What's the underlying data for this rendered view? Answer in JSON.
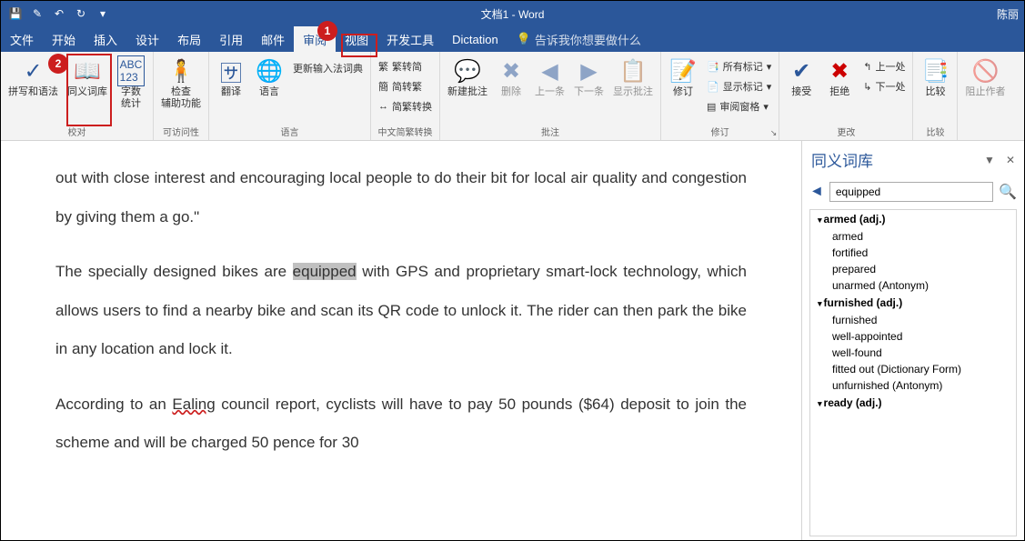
{
  "titlebar": {
    "doc_title": "文档1 - Word",
    "user": "陈丽"
  },
  "tabs": {
    "items": [
      "文件",
      "开始",
      "插入",
      "设计",
      "布局",
      "引用",
      "邮件",
      "审阅",
      "视图",
      "开发工具",
      "Dictation"
    ],
    "active_index": 7,
    "tell_me": "告诉我你想要做什么"
  },
  "badge1": "1",
  "badge2": "2",
  "ribbon": {
    "proofing": {
      "spelling": "拼写和语法",
      "thesaurus": "同义词库",
      "wordcount": "字数\n统计",
      "label": "校对"
    },
    "accessibility": {
      "check": "检查\n辅助功能",
      "label": "可访问性"
    },
    "language": {
      "translate": "翻译",
      "lang": "语言",
      "update_ime": "更新输入法词典",
      "label": "语言"
    },
    "chinese": {
      "sc": "繁转简",
      "tc": "简转繁",
      "convert": "简繁转换",
      "label": "中文简繁转换"
    },
    "comments": {
      "new": "新建批注",
      "delete": "删除",
      "prev": "上一条",
      "next": "下一条",
      "show": "显示批注",
      "label": "批注"
    },
    "tracking": {
      "track": "修订",
      "all_markup": "所有标记",
      "show_markup": "显示标记",
      "review_pane": "审阅窗格",
      "label": "修订"
    },
    "changes": {
      "accept": "接受",
      "reject": "拒绝",
      "prev": "上一处",
      "next": "下一处",
      "label": "更改"
    },
    "compare": {
      "compare": "比较",
      "label": "比较"
    },
    "protect": {
      "block": "阻止作者",
      "label": ""
    }
  },
  "doc": {
    "p1a": "out with close interest and encouraging local people to do their bit for local air quality and congestion by giving them a go.\"",
    "p2a": "The specially designed bikes are ",
    "p2_highlight": "equipped",
    "p2b": " with GPS and proprietary smart-lock technology, which allows users to find a nearby bike and scan its QR code to unlock it. The rider can then park the bike in any location and lock it.",
    "p3a": "According to an ",
    "p3_u": "Ealing",
    "p3b": " council report, cyclists will have to pay 50 pounds ($64) deposit to join the scheme and will be charged 50 pence for 30"
  },
  "thesaurus": {
    "title": "同义词库",
    "search": "equipped",
    "groups": [
      {
        "head": "armed (adj.)",
        "items": [
          "armed",
          "fortified",
          "prepared",
          "unarmed (Antonym)"
        ]
      },
      {
        "head": "furnished (adj.)",
        "items": [
          "furnished",
          "well-appointed",
          "well-found",
          "fitted out (Dictionary Form)",
          "unfurnished (Antonym)"
        ]
      },
      {
        "head": "ready (adj.)",
        "items": []
      }
    ]
  }
}
